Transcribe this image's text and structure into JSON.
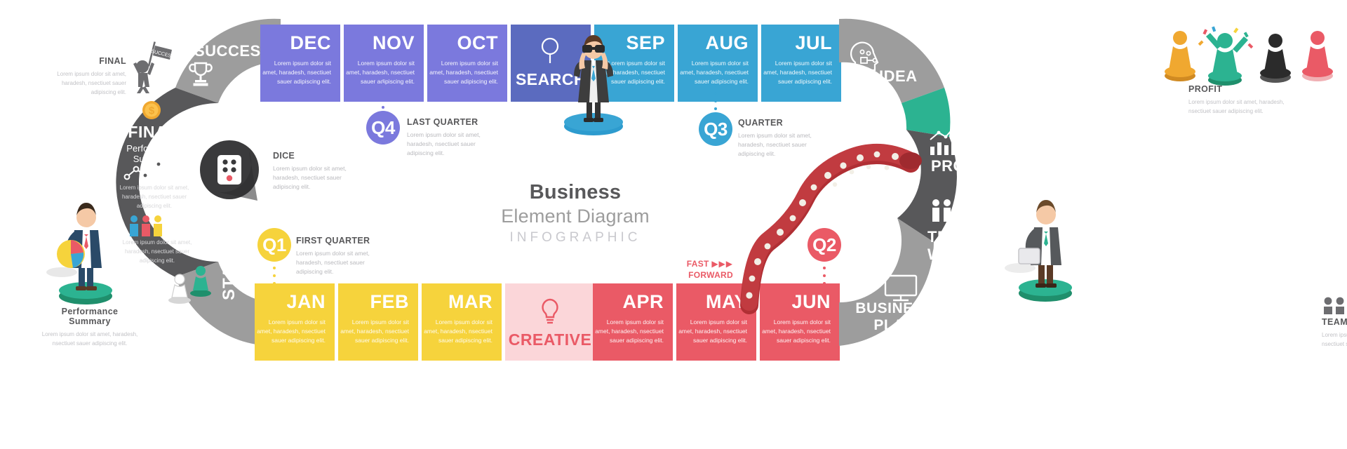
{
  "lorem": "Lorem ipsum dolor sit amet, haradesh, nsectiuet sauer adipiscing elit.",
  "center": {
    "line1": "Business",
    "line2": "Element Diagram",
    "line3": "INFOGRAPHIC"
  },
  "arcs": {
    "success": "SUCCESS",
    "final_title": "FINAL",
    "final_sub1": "Performance",
    "final_sub2": "Summary",
    "final_desc": "Lorem ipsum dolor sit amet, haradesh, nsectiuet sauer adipiscing elit.",
    "start": "START",
    "idea": "IDEA",
    "profit": "PROFIT",
    "team_line1": "TEAM",
    "team_line2": "WORK",
    "plan_line1": "BUSINESS",
    "plan_line2": "PLAN"
  },
  "top_months": [
    {
      "label": "DEC",
      "desc": "Lorem ipsum dolor sit amet, haradesh, nsectiuet sauer adipiscing elit.",
      "color": "#7b79dd"
    },
    {
      "label": "NOV",
      "desc": "Lorem ipsum dolor sit amet, haradesh, nsectiuet sauer adipiscing elit.",
      "color": "#7b79dd"
    },
    {
      "label": "OCT",
      "desc": "Lorem ipsum dolor sit amet, haradesh, nsectiuet sauer adipiscing elit.",
      "color": "#7b79dd"
    },
    {
      "label": "SEP",
      "desc": "Lorem ipsum dolor sit amet, haradesh, nsectiuet sauer adipiscing elit.",
      "color": "#39a5d4"
    },
    {
      "label": "AUG",
      "desc": "Lorem ipsum dolor sit amet, haradesh, nsectiuet sauer adipiscing elit.",
      "color": "#39a5d4"
    },
    {
      "label": "JUL",
      "desc": "Lorem ipsum dolor sit amet, haradesh, nsectiuet sauer adipiscing elit.",
      "color": "#39a5d4"
    }
  ],
  "bottom_months": [
    {
      "label": "JAN",
      "desc": "Lorem ipsum dolor sit amet, haradesh, nsectiuet sauer adipiscing elit.",
      "color": "#f6d33c"
    },
    {
      "label": "FEB",
      "desc": "Lorem ipsum dolor sit amet, haradesh, nsectiuet sauer adipiscing elit.",
      "color": "#f6d33c"
    },
    {
      "label": "MAR",
      "desc": "Lorem ipsum dolor sit amet, haradesh, nsectiuet sauer adipiscing elit.",
      "color": "#f6d33c"
    },
    {
      "label": "APR",
      "desc": "Lorem ipsum dolor sit amet, haradesh, nsectiuet sauer adipiscing elit.",
      "color": "#ea5a66"
    },
    {
      "label": "MAY",
      "desc": "Lorem ipsum dolor sit amet, haradesh, nsectiuet sauer adipiscing elit.",
      "color": "#ea5a66"
    },
    {
      "label": "JUN",
      "desc": "Lorem ipsum dolor sit amet, haradesh, nsectiuet sauer adipiscing elit.",
      "color": "#ea5a66"
    }
  ],
  "search_card": {
    "label": "SEARCH",
    "icon": "magnifier-icon",
    "color": "#5b6bbf"
  },
  "creative_card": {
    "label": "CREATIVE",
    "icon": "lightbulb-icon",
    "color": "#fbd6d9"
  },
  "quarters": [
    {
      "id": "Q1",
      "badge": "Q1",
      "title": "FIRST QUARTER",
      "desc": "Lorem ipsum dolor sit amet, haradesh, nsectiuet sauer adipiscing elit.",
      "color": "#f6d33c"
    },
    {
      "id": "Q2",
      "badge": "Q2",
      "title": "",
      "desc": "",
      "color": "#ea5a66"
    },
    {
      "id": "Q3",
      "badge": "Q3",
      "title": "QUARTER",
      "desc": "Lorem ipsum dolor sit amet, haradesh, nsectiuet sauer adipiscing elit.",
      "color": "#39a5d4"
    },
    {
      "id": "Q4",
      "badge": "Q4",
      "title": "LAST QUARTER",
      "desc": "Lorem ipsum dolor sit amet, haradesh, nsectiuet sauer adipiscing elit.",
      "color": "#7b79dd"
    }
  ],
  "dice": {
    "title": "DICE",
    "desc": "Lorem ipsum dolor sit amet, haradesh, nsectiuet sauer adipiscing elit."
  },
  "fast_forward": {
    "line1": "FAST",
    "line2": "FORWARD"
  },
  "side_captions": {
    "final_top": {
      "title": "FINAL",
      "desc": "Lorem ipsum dolor sit amet, haradesh, nsectiuet sauer adipiscing elit."
    },
    "perf_bottom": {
      "title_line1": "Performance",
      "title_line2": "Summary",
      "desc": "Lorem ipsum dolor sit amet, haradesh, nsectiuet sauer adipiscing elit."
    },
    "profit_right": {
      "title": "PROFIT",
      "desc": "Lorem ipsum dolor sit amet, haradesh, nsectiuet sauer adipiscing elit."
    },
    "teamwork_right": {
      "title": "TEAM WORK",
      "desc": "Lorem ipsum dolor sit amet, haradesh, nsectiuet sauer adipiscing elit."
    }
  },
  "colors": {
    "purple": "#7b79dd",
    "blue": "#39a5d4",
    "search_blue": "#5b6bbf",
    "yellow": "#f6d33c",
    "red": "#ea5a66",
    "pink": "#fbd6d9",
    "grey": "#9d9d9d",
    "dark_grey": "#58585a",
    "green": "#2cb391",
    "orange": "#f0a830"
  }
}
